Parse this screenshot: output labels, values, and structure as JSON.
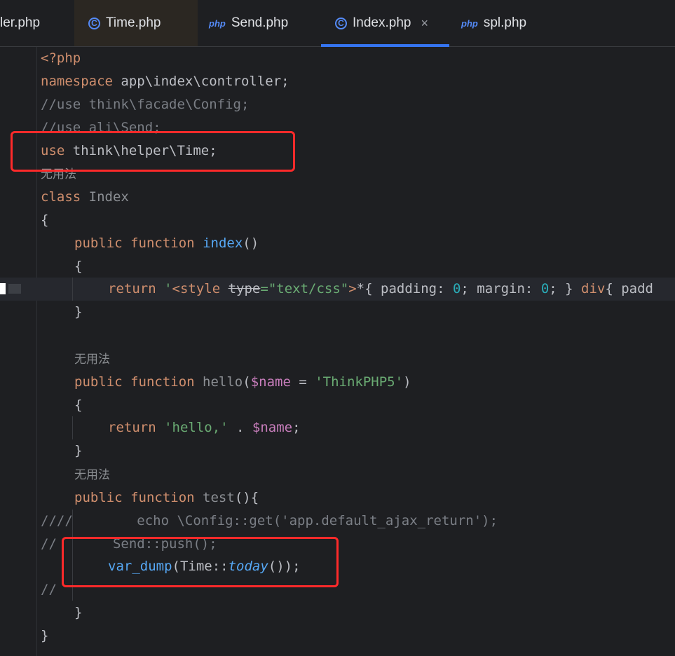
{
  "tabs": [
    {
      "label": "ler.php"
    },
    {
      "label": "Time.php",
      "icon": "class-icon"
    },
    {
      "label": "Send.php",
      "icon": "php-icon",
      "icon_text": "php"
    },
    {
      "label": "Index.php",
      "icon": "class-icon",
      "close": "×"
    },
    {
      "label": "spl.php",
      "icon": "php-icon",
      "icon_text": "php"
    }
  ],
  "code": {
    "open_tag": "<?php",
    "namespace_kw": "namespace",
    "namespace_rest": " app\\index\\controller;",
    "comment_use_config": "//use think\\facade\\Config;",
    "comment_use_send": "//use ali\\Send;",
    "use_kw": "use",
    "use_rest": " think\\helper\\Time;",
    "hint_unused": "无用法",
    "class_kw": "class",
    "class_name": " Index",
    "brace_open": "{",
    "brace_close": "}",
    "public_kw": "public",
    "function_kw": "function",
    "index_fn": "index",
    "parens": "()",
    "return_kw": "return",
    "style_q": " '",
    "style_tag": "<style ",
    "style_attr": "type",
    "style_eq": "=",
    "style_val": "\"text/css\"",
    "style_gt": ">",
    "style_star": "*",
    "style_p1": "{ padding: ",
    "zero": "0",
    "style_p2": "; margin: ",
    "style_p3": "; } ",
    "style_div": "div",
    "style_p4": "{ padd",
    "hello_fn": " hello",
    "paren_open": "(",
    "name_var": "$name",
    "eq": " = ",
    "thinkphp_str": "'ThinkPHP5'",
    "paren_close": ")",
    "hello_str": " 'hello,'",
    "concat": " . ",
    "semicolon": ";",
    "test_fn": " test",
    "test_rest": "(){",
    "echo_line": "////        echo \\Config::get('app.default_ajax_return');",
    "send_line": "//       Send::push();",
    "var_dump_fn": "var_dump",
    "time_class": "(Time::",
    "today_fn": "today",
    "call_end": "());",
    "comment_empty": "//"
  }
}
